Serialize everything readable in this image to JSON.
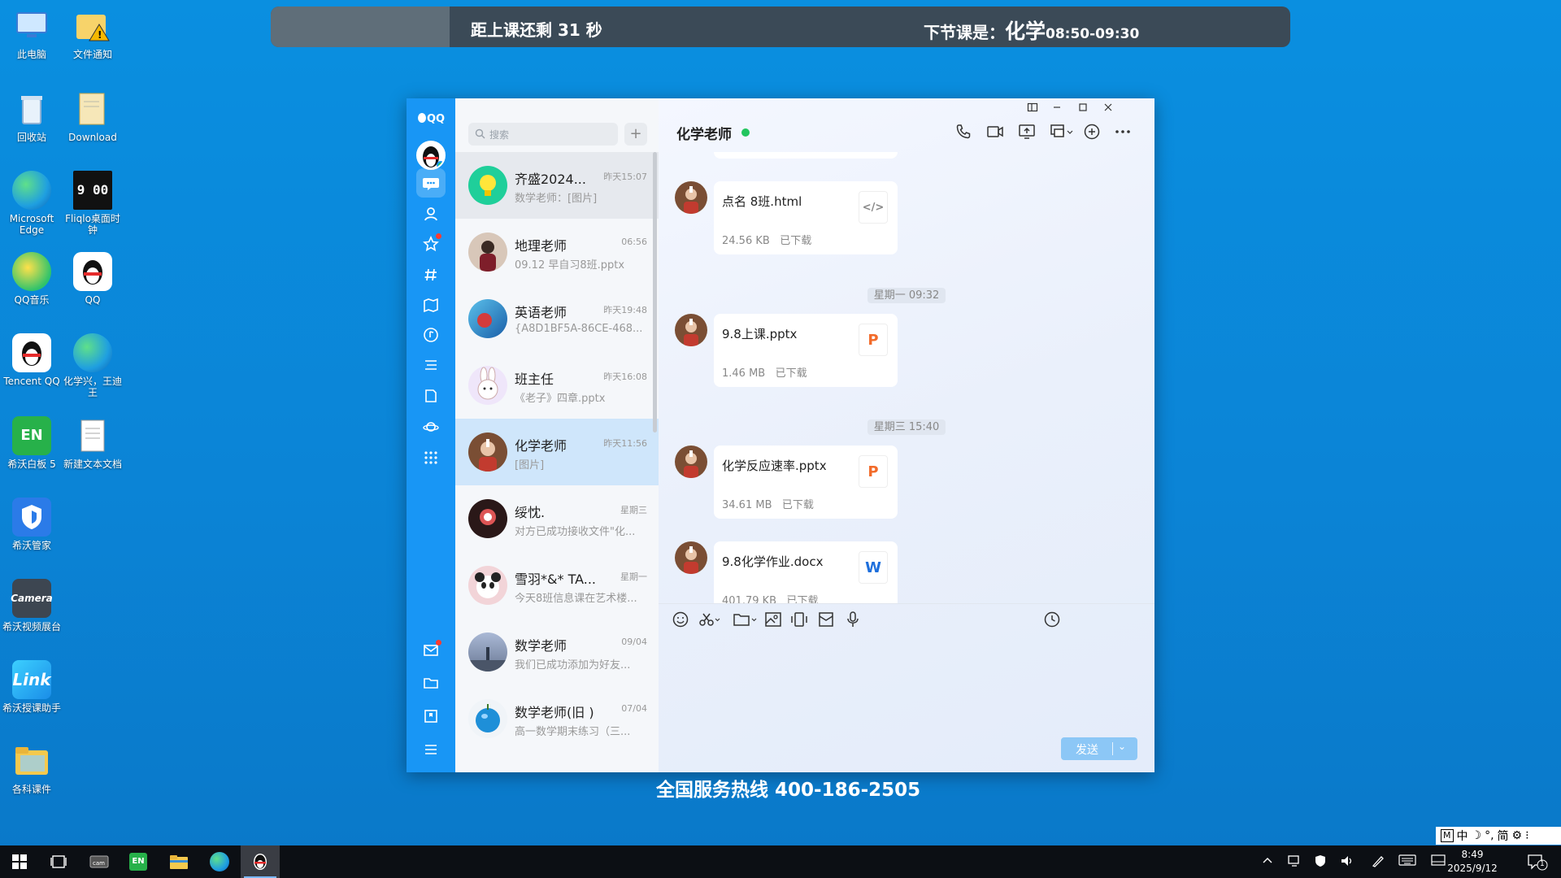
{
  "desktop": {
    "icons": [
      {
        "label": "此电脑",
        "icon": "computer-icon"
      },
      {
        "label": "文件通知",
        "icon": "folder-warning-icon"
      },
      {
        "label": "回收站",
        "icon": "recycle-bin-icon"
      },
      {
        "label": "Download",
        "icon": "download-folder-icon"
      },
      {
        "label": "Microsoft Edge",
        "icon": "edge-icon"
      },
      {
        "label": "Fliqlo桌面时钟",
        "icon": "flip-clock-icon"
      },
      {
        "label": "QQ音乐",
        "icon": "qq-music-icon"
      },
      {
        "label": "QQ",
        "icon": "qq-penguin-icon"
      },
      {
        "label": "Tencent QQ",
        "icon": "qq-penguin-icon"
      },
      {
        "label": "化学兴，王迪王",
        "icon": "edge-icon"
      },
      {
        "label": "希沃白板 5",
        "icon": "easinote-icon"
      },
      {
        "label": "新建文本文档",
        "icon": "text-file-icon"
      },
      {
        "label": "希沃管家",
        "icon": "shield-icon"
      },
      {
        "label": "希沃视频展台",
        "icon": "camera-icon"
      },
      {
        "label": "希沃授课助手",
        "icon": "link-icon"
      },
      {
        "label": "各科课件",
        "icon": "folder-icon"
      }
    ],
    "clock_face": "9 00"
  },
  "banner": {
    "countdown": "距上课还剩 31 秒",
    "next_label": "下节课是：",
    "next_subject": "化学",
    "next_time": "08:50-09:30"
  },
  "qq": {
    "logo": "QQ",
    "search_placeholder": "搜索",
    "add_label": "+",
    "conversations": [
      {
        "name": "齐盛2024...",
        "time": "昨天15:07",
        "msg": "数学老师：[图片]",
        "avatar_color": "#1fcf9a"
      },
      {
        "name": "地理老师",
        "time": "06:56",
        "msg": "09.12 早自习8班.pptx",
        "avatar_color": "#c9b3a3"
      },
      {
        "name": "英语老师",
        "time": "昨天19:48",
        "msg": "{A8D1BF5A-86CE-468...",
        "avatar_color": "#2e86c1"
      },
      {
        "name": "班主任",
        "time": "昨天16:08",
        "msg": "《老子》四章.pptx",
        "avatar_color": "#e8dcf5"
      },
      {
        "name": "化学老师",
        "time": "昨天11:56",
        "msg": "[图片]",
        "avatar_color": "#8a5a3c"
      },
      {
        "name": "绥忱.",
        "time": "星期三",
        "msg": "对方已成功接收文件\"化...",
        "avatar_color": "#3a2020"
      },
      {
        "name": "雪羽*&* TA...",
        "time": "星期一",
        "msg": "今天8班信息课在艺术楼...",
        "avatar_color": "#e85c6a"
      },
      {
        "name": "数学老师",
        "time": "09/04",
        "msg": "我们已成功添加为好友...",
        "avatar_color": "#7a93b8"
      },
      {
        "name": "数学老师(旧 )",
        "time": "07/04",
        "msg": "高一数学期末练习（三...",
        "avatar_color": "#2a9ad8"
      }
    ],
    "chat": {
      "title": "化学老师",
      "messages": [
        {
          "type": "file",
          "name": "点名 8班.html",
          "size": "24.56 KB",
          "status": "已下载",
          "kind": "code"
        },
        {
          "type": "time",
          "text": "星期一 09:32"
        },
        {
          "type": "file",
          "name": "9.8上课.pptx",
          "size": "1.46 MB",
          "status": "已下载",
          "kind": "ppt"
        },
        {
          "type": "time",
          "text": "星期三 15:40"
        },
        {
          "type": "file",
          "name": "化学反应速率.pptx",
          "size": "34.61 MB",
          "status": "已下载",
          "kind": "ppt"
        },
        {
          "type": "file",
          "name": "9.8化学作业.docx",
          "size": "401.79 KB",
          "status": "已下载",
          "kind": "word"
        }
      ],
      "send_label": "发送",
      "send_arrow": "⌄"
    }
  },
  "hotline": "全国服务热线 400-186-2505",
  "ime": {
    "mode": "中",
    "simplified": "简"
  },
  "taskbar": {
    "time": "8:49",
    "date": "2025/9/12",
    "notification_count": "1"
  },
  "colors": {
    "accent": "#1896f5",
    "banner_bg": "#3b4a57",
    "online": "#22c55e",
    "ppt": "#f26b2a",
    "word": "#1e6fdc"
  }
}
